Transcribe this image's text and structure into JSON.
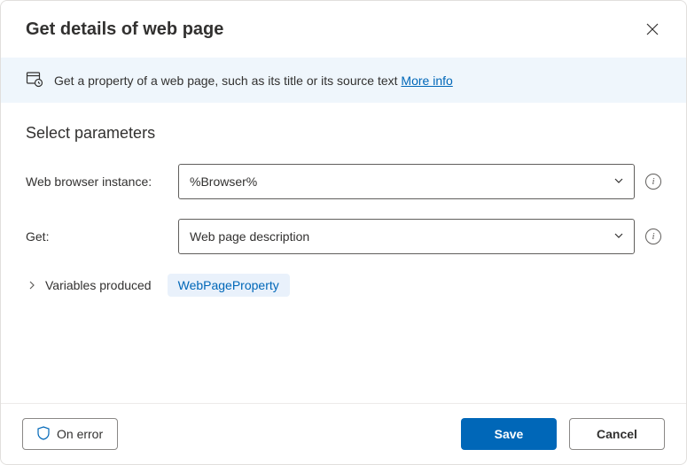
{
  "header": {
    "title": "Get details of web page"
  },
  "info": {
    "description": "Get a property of a web page, such as its title or its source text ",
    "more_info_label": "More info"
  },
  "parameters": {
    "section_title": "Select parameters",
    "browser_label": "Web browser instance:",
    "browser_value": "%Browser%",
    "get_label": "Get:",
    "get_value": "Web page description"
  },
  "variables": {
    "label": "Variables produced",
    "produced": "WebPageProperty"
  },
  "footer": {
    "on_error": "On error",
    "save": "Save",
    "cancel": "Cancel"
  }
}
